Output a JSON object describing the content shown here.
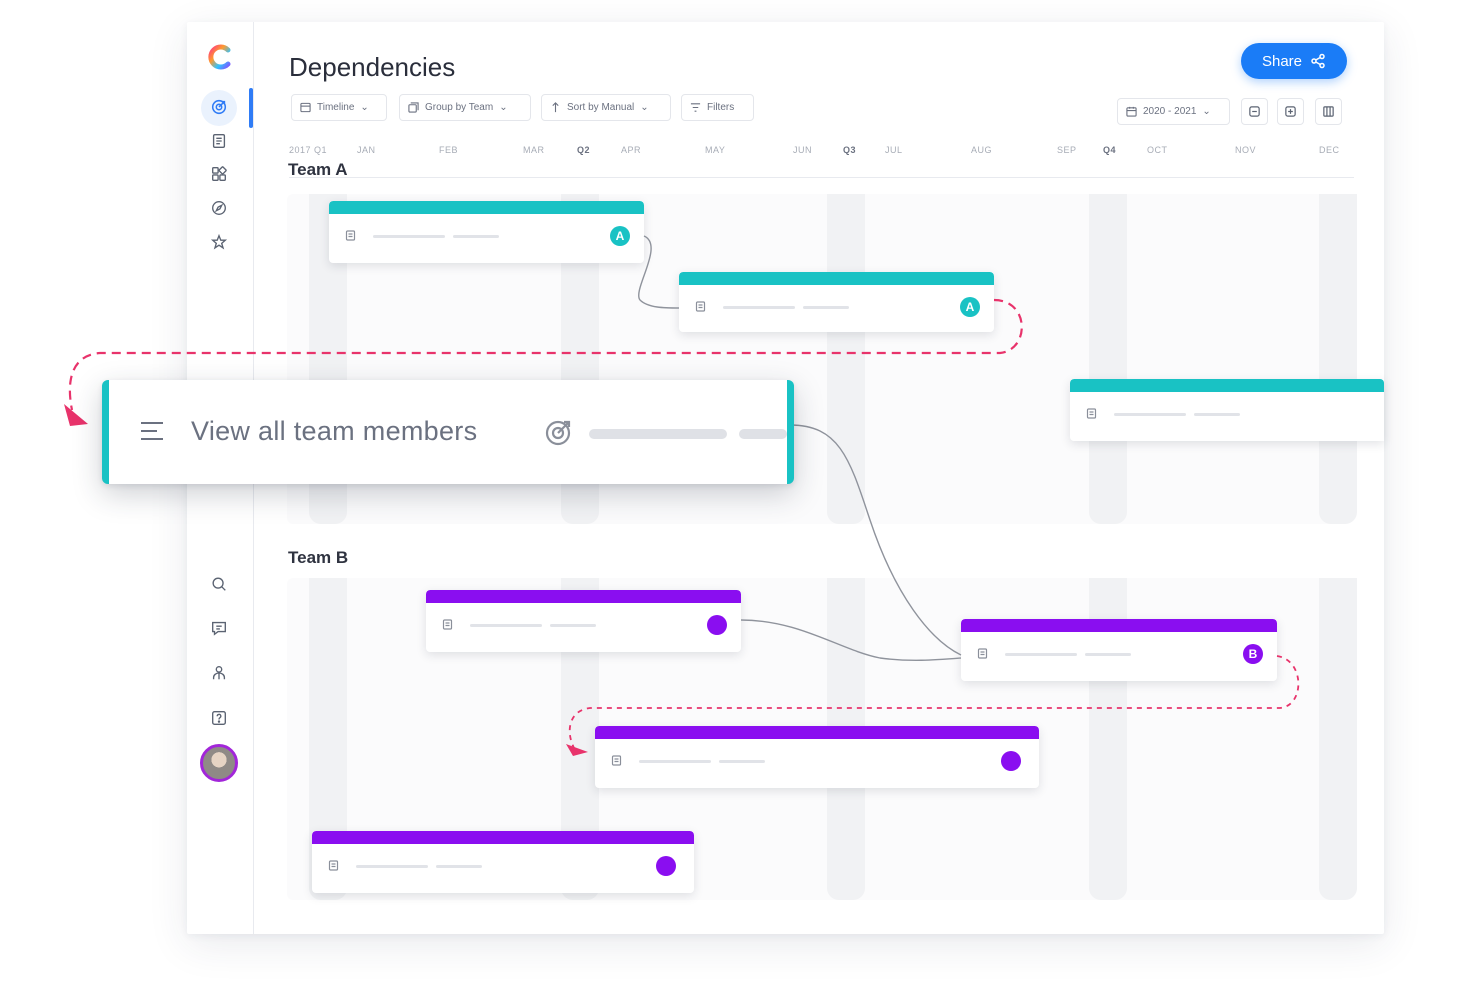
{
  "app": {
    "title": "Dependencies",
    "share_label": "Share",
    "logo_letter": "C",
    "colors": {
      "accent_blue": "#1a7cf7",
      "team_a": "#19c2c4",
      "team_b": "#8a0ef0",
      "dependency_arrow": "#e8336b"
    }
  },
  "sidebar": {
    "top_items": [
      {
        "icon": "goals-icon"
      },
      {
        "icon": "docs-icon"
      },
      {
        "icon": "apps-icon"
      },
      {
        "icon": "compass-icon"
      },
      {
        "icon": "star-icon"
      }
    ],
    "bottom_items": [
      {
        "icon": "search-icon"
      },
      {
        "icon": "chat-icon"
      },
      {
        "icon": "people-icon"
      },
      {
        "icon": "help-icon"
      }
    ]
  },
  "toolbar": {
    "view": "Timeline",
    "group": "Group by Team",
    "sort": "Sort by Manual",
    "filters": "Filters",
    "date_range": "2020 - 2021"
  },
  "timeline": {
    "months": [
      "2017 Q1",
      "JAN",
      "FEB",
      "MAR",
      "Q2",
      "APR",
      "MAY",
      "JUN",
      "Q3",
      "JUL",
      "AUG",
      "SEP",
      "Q4",
      "OCT",
      "NOV",
      "DEC"
    ]
  },
  "teams": [
    {
      "name": "Team A",
      "badge": "A"
    },
    {
      "name": "Team B",
      "badge": "B"
    }
  ],
  "popup": {
    "label": "View all team members"
  }
}
